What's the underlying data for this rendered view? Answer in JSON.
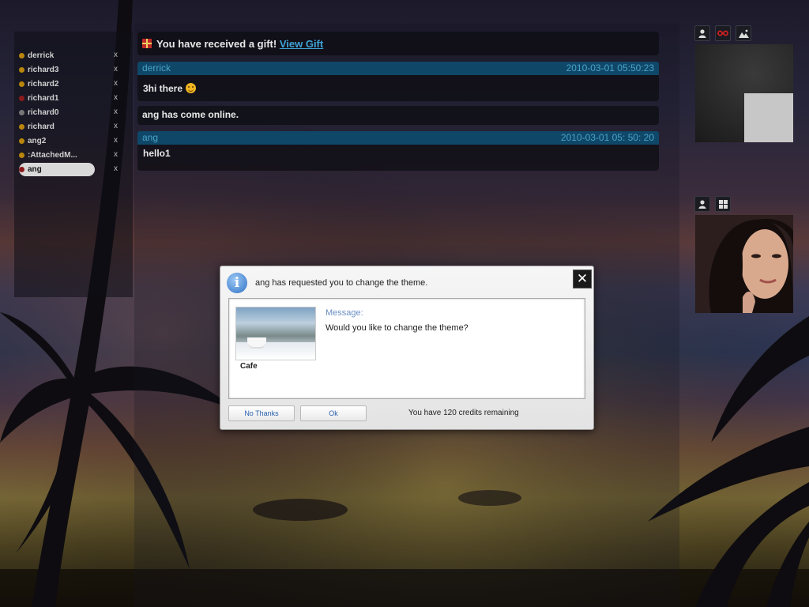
{
  "contacts": [
    {
      "name": "derrick",
      "status_color": "#b8860b"
    },
    {
      "name": "richard3",
      "status_color": "#b8860b"
    },
    {
      "name": "richard2",
      "status_color": "#b8860b"
    },
    {
      "name": "richard1",
      "status_color": "#8b1a1a"
    },
    {
      "name": "richard0",
      "status_color": "#777777"
    },
    {
      "name": "richard",
      "status_color": "#b8860b"
    },
    {
      "name": "ang2",
      "status_color": "#b8860b"
    },
    {
      "name": ":AttachedM...",
      "status_color": "#b8860b"
    },
    {
      "name": "ang",
      "status_color": "#8b1a1a",
      "selected": true
    }
  ],
  "contact_close_glyph": "x",
  "gift": {
    "text": "You have received a gift!",
    "link": "View Gift"
  },
  "messages": [
    {
      "sender": "derrick",
      "timestamp": "2010-03-01 05:50:23",
      "text": "3hi there"
    },
    {
      "system": "ang has come online."
    },
    {
      "sender": "ang",
      "timestamp": "2010-03-01 05: 50: 20",
      "text": "hello1"
    }
  ],
  "dialog": {
    "title": "ang has requested you to change the theme.",
    "close_glyph": "✕",
    "info_glyph": "i",
    "thumb_label": "Cafe",
    "message_label": "Message:",
    "message_body": "Would you like to change the theme?",
    "no_button": "No Thanks",
    "ok_button": "Ok",
    "credits": "You have 120 credits remaining"
  },
  "icons": {
    "video1_toolbar": [
      "user-icon",
      "glasses-icon",
      "picture-icon"
    ],
    "video2_toolbar": [
      "user-icon",
      "grid-icon"
    ]
  },
  "colors": {
    "header_bar": "#0f4768",
    "header_text": "#4aa3c8",
    "link": "#3fa4d6",
    "dialog_label": "#6a8ec4"
  }
}
